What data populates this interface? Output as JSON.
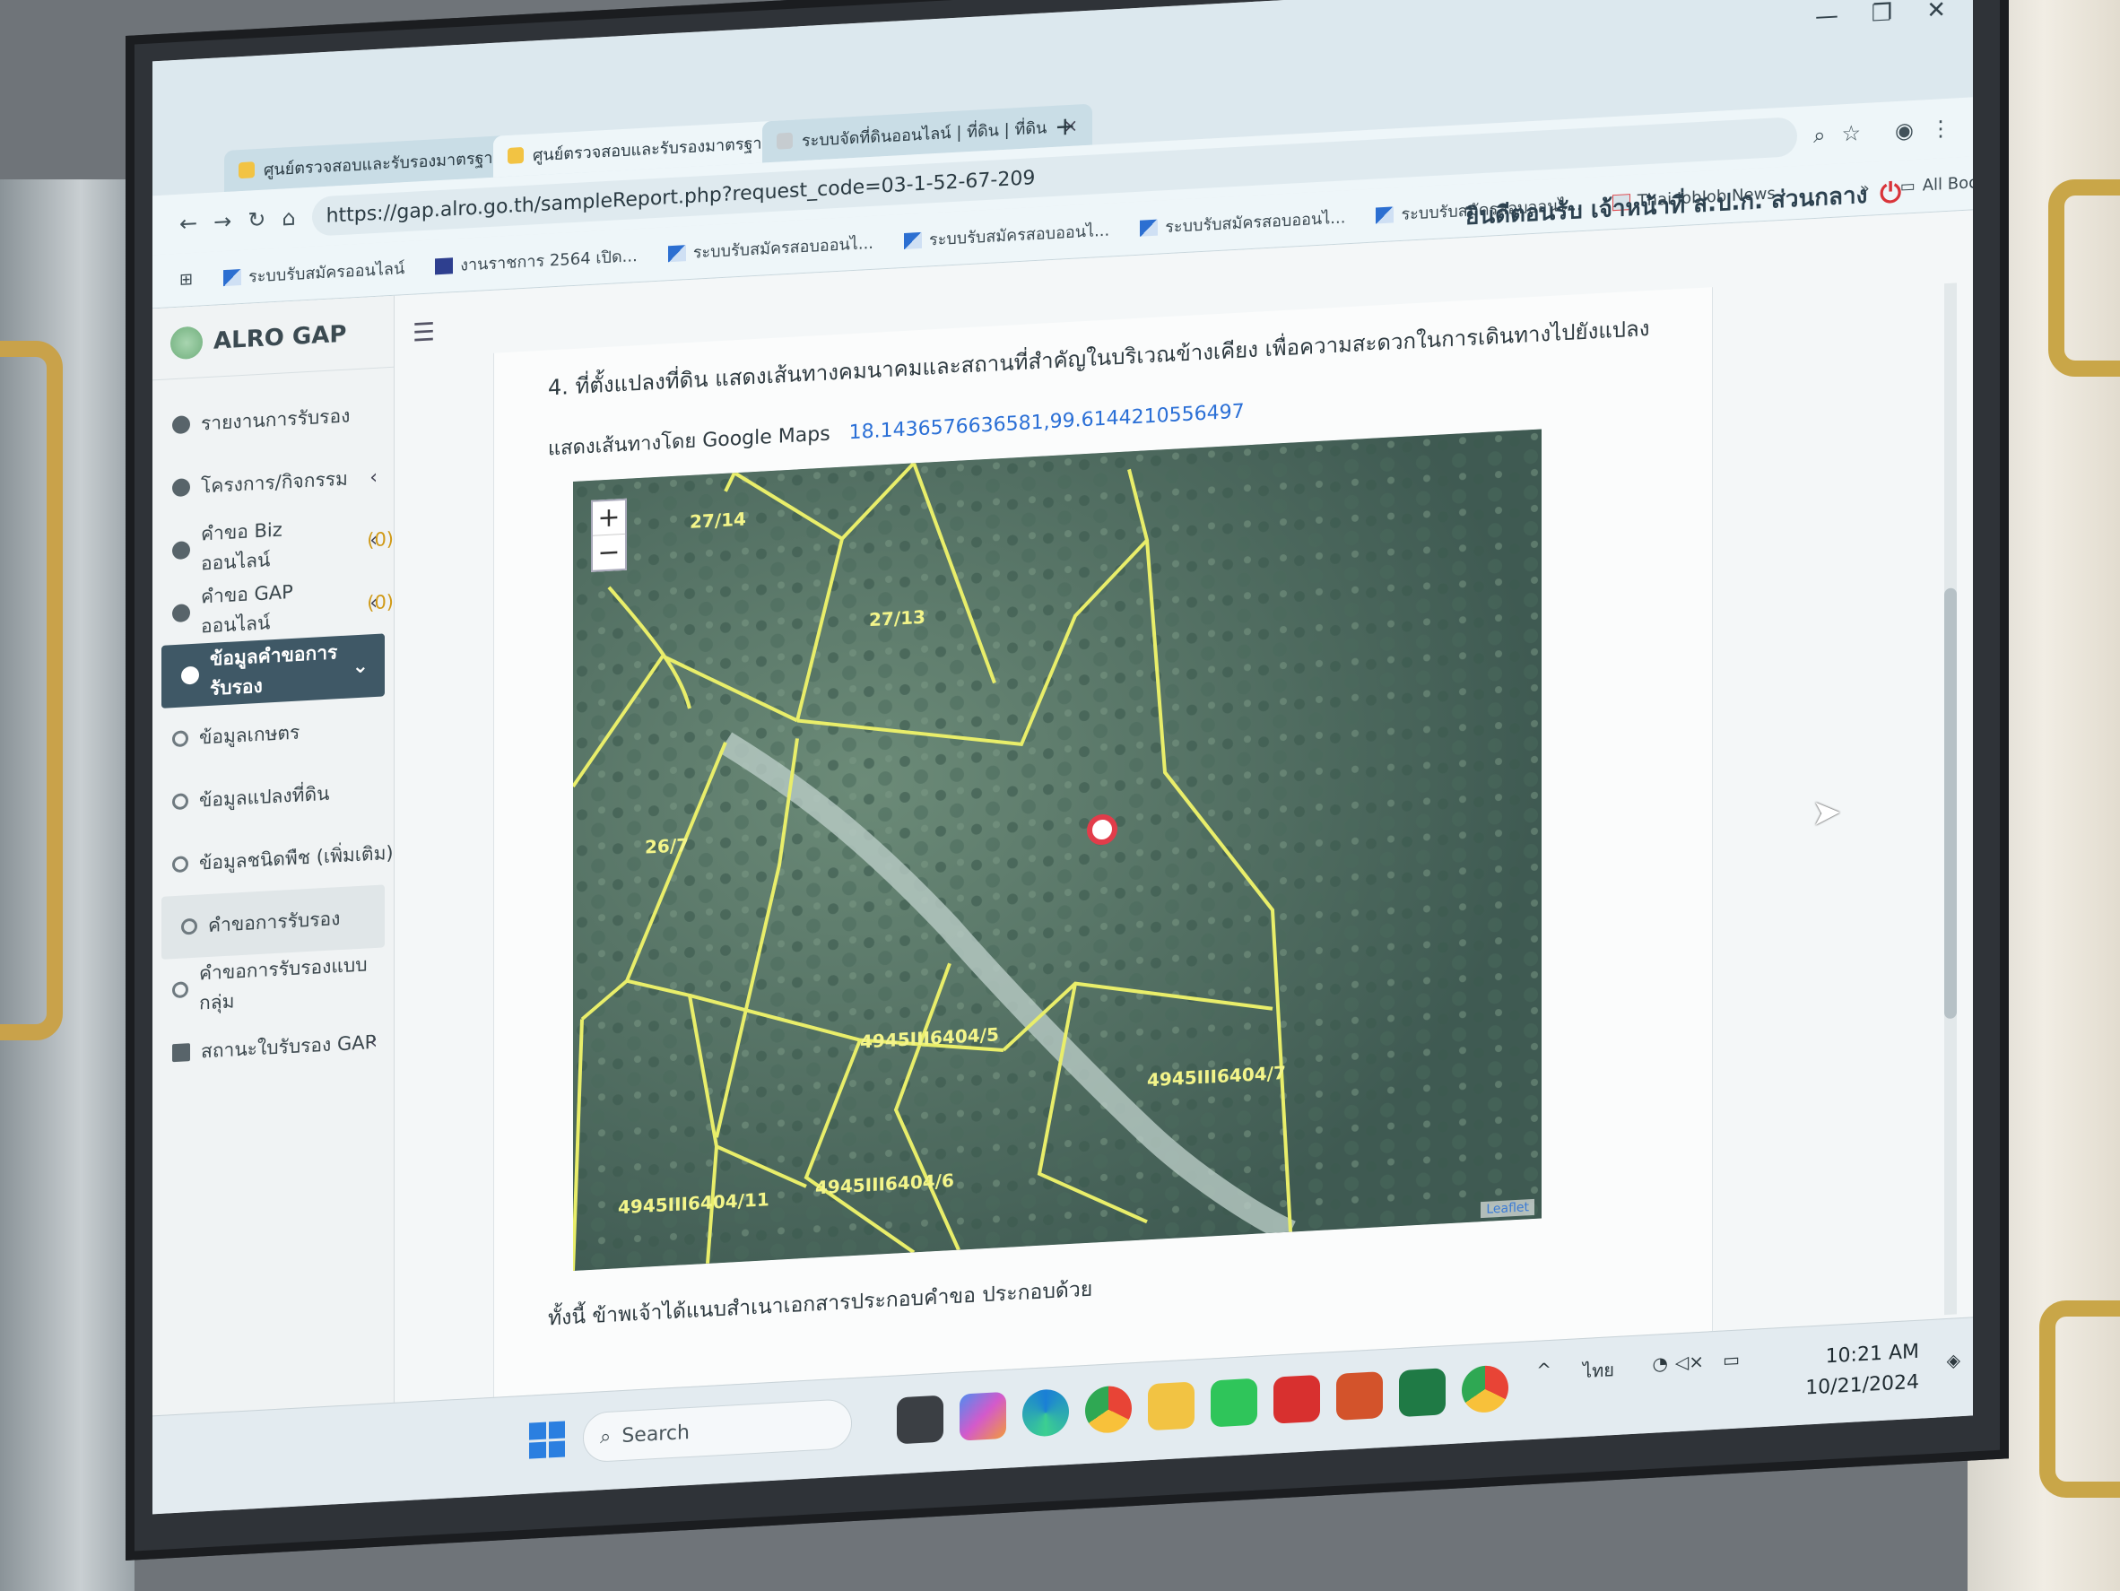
{
  "browser": {
    "tabs": [
      {
        "label": "ศูนย์ตรวจสอบและรับรองมาตรฐานสินค้า",
        "active": false
      },
      {
        "label": "ศูนย์ตรวจสอบและรับรองมาตรฐานสินค้า",
        "active": true
      },
      {
        "label": "ระบบจัดที่ดินออนไลน์ | ที่ดิน | ที่ดิน",
        "active": false
      }
    ],
    "new_tab": "+",
    "url": "https://gap.alro.go.th/sampleReport.php?request_code=03-1-52-67-209",
    "bookmarks": [
      "ระบบรับสมัครออนไลน์",
      "งานราชการ 2564 เปิด...",
      "ระบบรับสมัครสอบออนไ...",
      "ระบบรับสมัครสอบออนไ...",
      "ระบบรับสมัครสอบออนไ...",
      "ระบบรับสมัครสอบออนไ...",
      "Thai JobJob News"
    ],
    "all_bookmarks": "All Bookmarks",
    "more": "»"
  },
  "site": {
    "brand": "ALRO GAP",
    "welcome": "ยินดีตอนรับ เจ้าหน้าที่ ส.ป.ก. ส่วนกลาง",
    "menu_toggle": "☰",
    "nav": [
      {
        "label": "รายงานการรับรอง",
        "icon": "dashboard-icon"
      },
      {
        "label": "โครงการ/กิจกรรม",
        "icon": "gear-icon",
        "chevron": "‹"
      },
      {
        "label": "คำขอ Biz ออนไลน์",
        "count": "(0)",
        "icon": "globe-icon",
        "chevron": "‹"
      },
      {
        "label": "คำขอ GAP ออนไลน์",
        "count": "(0)",
        "icon": "globe-icon",
        "chevron": "‹"
      },
      {
        "label": "ข้อมูลคำขอการรับรอง",
        "icon": "database-icon",
        "chevron": "⌄"
      },
      {
        "label": "ข้อมูลเกษตร",
        "icon": "circle-icon"
      },
      {
        "label": "ข้อมูลแปลงที่ดิน",
        "icon": "circle-icon"
      },
      {
        "label": "ข้อมูลชนิดพืช (เพิ่มเติม)",
        "icon": "circle-icon"
      },
      {
        "label": "คำขอการรับรอง",
        "icon": "circle-icon"
      },
      {
        "label": "คำขอการรับรองแบบกลุ่ม",
        "icon": "circle-icon"
      },
      {
        "label": "สถานะใบรับรอง GAP",
        "icon": "document-icon",
        "chevron": "‹"
      }
    ],
    "section_title": "4. ที่ตั้งแปลงที่ดิน แสดงเส้นทางคมนาคมและสถานที่สำคัญในบริเวณข้างเคียง เพื่อความสะดวกในการเดินทางไปยังแปลง",
    "gmaps_label": "แสดงเส้นทางโดย Google Maps",
    "gmaps_coords": "18.1436576636581,99.6144210556497",
    "map": {
      "zoom_in": "+",
      "zoom_out": "−",
      "attribution": "Leaflet",
      "parcel_labels": [
        "27/14",
        "27/13",
        "26/7",
        "4945III6404/5",
        "4945III6404/7",
        "4945III6404/11",
        "4945III6404/6"
      ]
    },
    "footer_text": "ทั้งนี้ ข้าพเจ้าได้แนบสำเนาเอกสารประกอบคำขอ ประกอบด้วย"
  },
  "taskbar": {
    "search_placeholder": "Search",
    "language": "ไทย",
    "time": "10:21 AM",
    "date": "10/21/2024"
  },
  "colors": {
    "accent": "#3f5866",
    "link": "#2a6fd6",
    "parcel_line": "#e9ee6a",
    "power": "#d9343a"
  }
}
